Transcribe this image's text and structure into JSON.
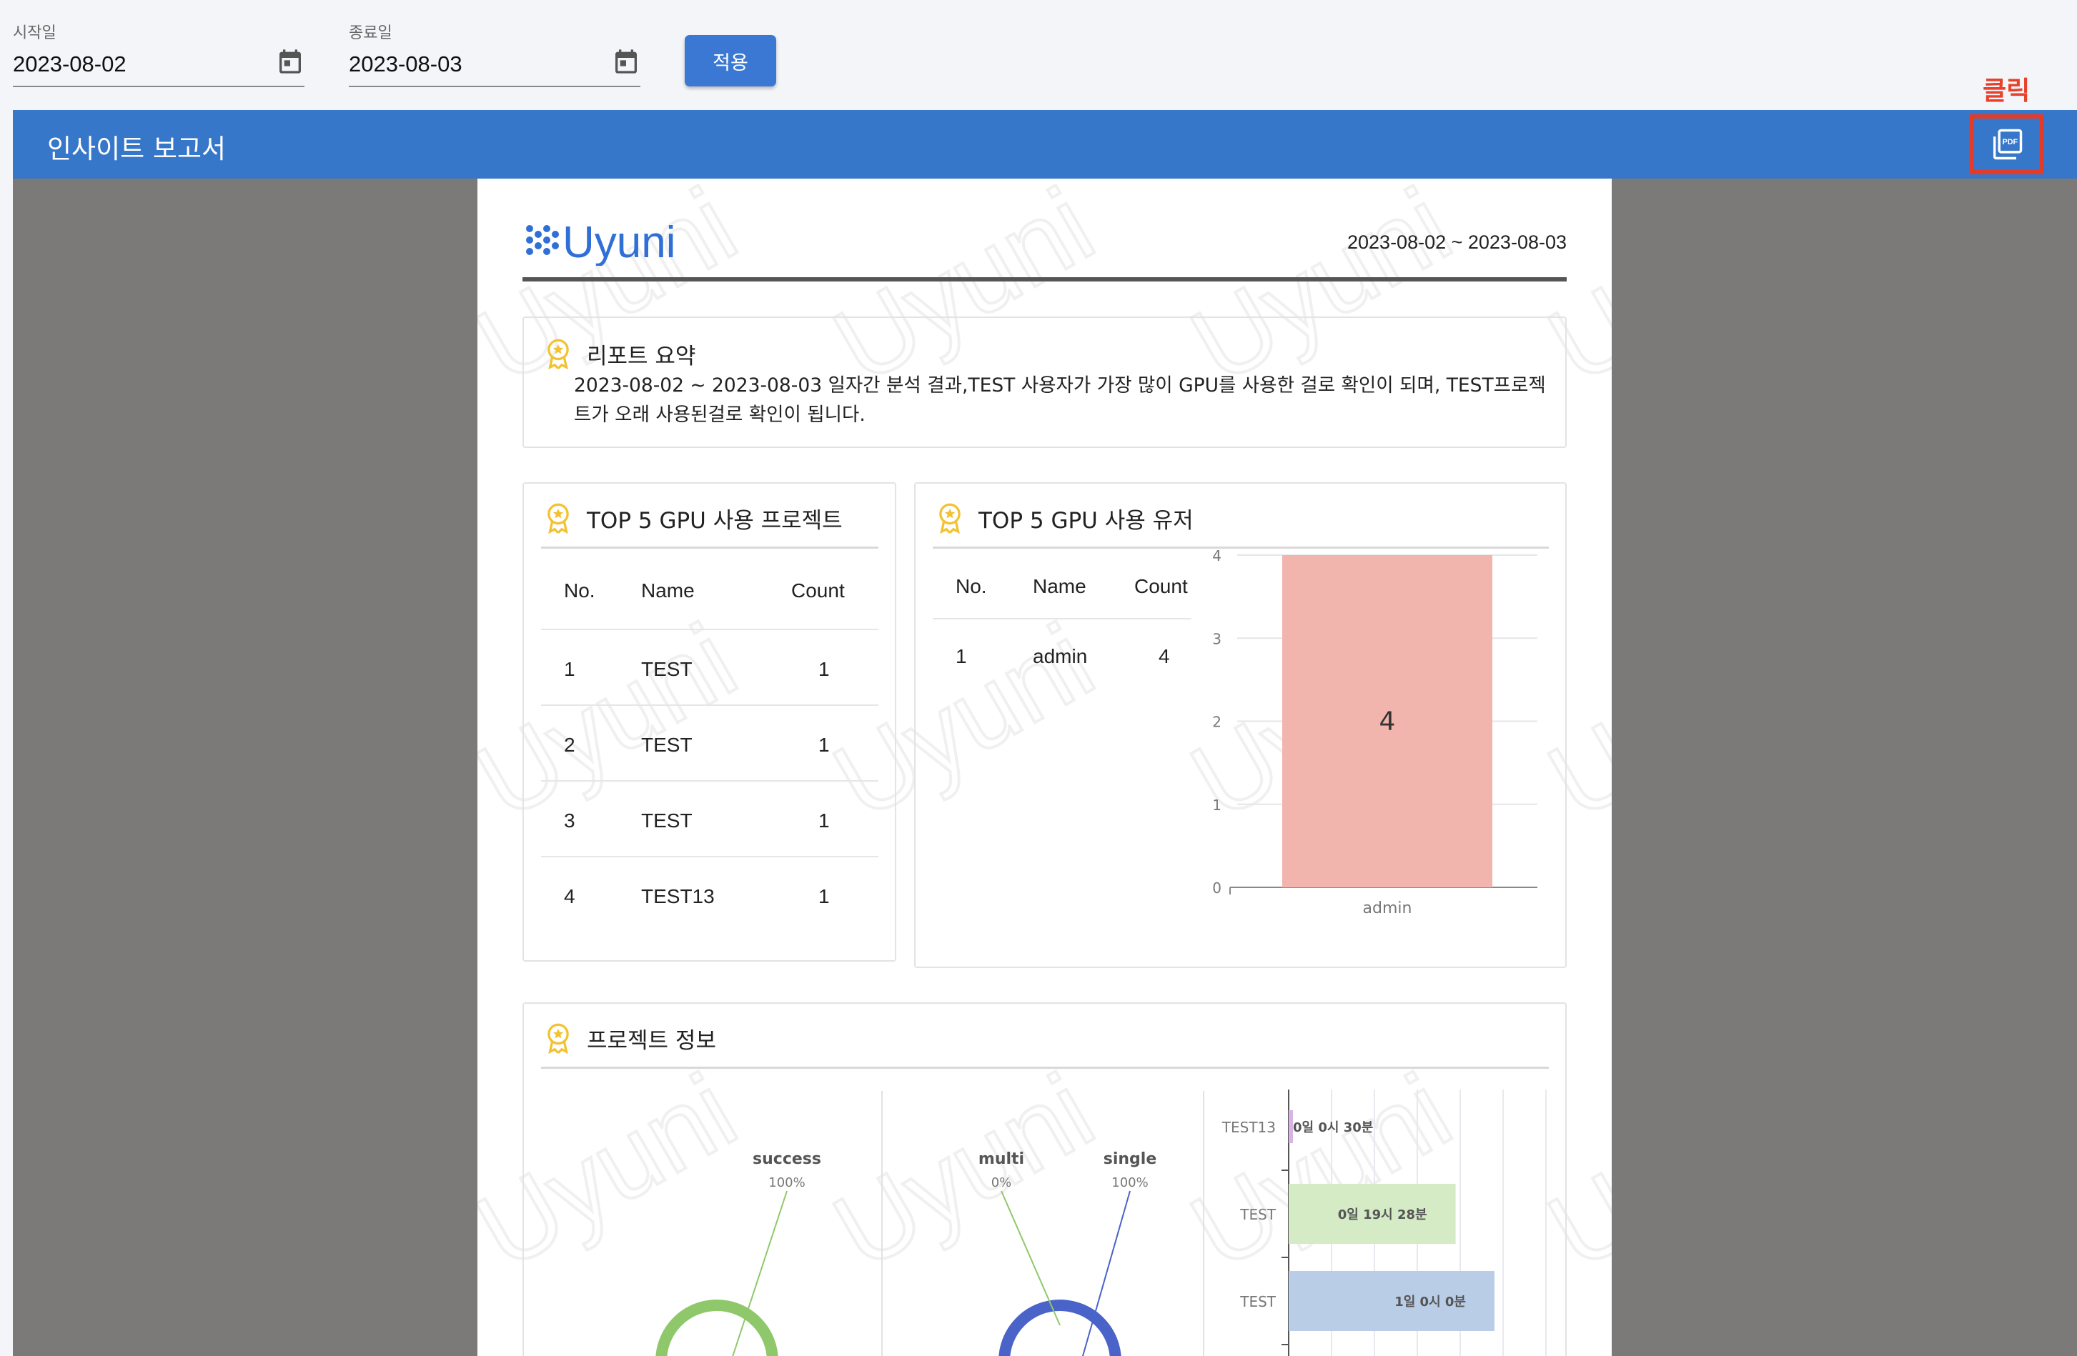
{
  "filters": {
    "start": {
      "label": "시작일",
      "value": "2023-08-02",
      "icon": "calendar-icon"
    },
    "end": {
      "label": "종료일",
      "value": "2023-08-03",
      "icon": "calendar-icon"
    },
    "apply_label": "적용"
  },
  "annotation": {
    "text": "클릭",
    "color": "#e23b2a"
  },
  "report_bar": {
    "title": "인사이트 보고서",
    "pdf_icon": "pdf-icon",
    "pdf_icon_text": "PDF",
    "color": "#3677c9"
  },
  "report": {
    "logo_text": "Uyuni",
    "period": "2023-08-02 ~ 2023-08-03",
    "watermark": "Uyuni",
    "summary": {
      "title": "리포트 요약",
      "text": "2023-08-02 ~ 2023-08-03 일자간 분석 결과,TEST 사용자가 가장 많이 GPU를 사용한 걸로 확인이 되며, TEST프로젝트가 오래 사용된걸로 확인이 됩니다."
    },
    "top_projects": {
      "title": "TOP 5 GPU 사용 프로젝트",
      "columns": [
        "No.",
        "Name",
        "Count"
      ],
      "rows": [
        [
          "1",
          "TEST",
          "1"
        ],
        [
          "2",
          "TEST",
          "1"
        ],
        [
          "3",
          "TEST",
          "1"
        ],
        [
          "4",
          "TEST13",
          "1"
        ]
      ]
    },
    "top_users": {
      "title": "TOP 5 GPU 사용 유저",
      "columns": [
        "No.",
        "Name",
        "Count"
      ],
      "rows": [
        [
          "1",
          "admin",
          "4"
        ]
      ]
    },
    "project_info": {
      "title": "프로젝트 정보"
    }
  },
  "chart_data": [
    {
      "type": "bar",
      "categories": [
        "admin"
      ],
      "values": [
        4
      ],
      "ylim": [
        0,
        4
      ],
      "yticks": [
        "0",
        "1",
        "2",
        "3",
        "4"
      ],
      "data_labels": [
        "4"
      ],
      "grid": true,
      "colors": [
        "#f2b5ae"
      ]
    },
    {
      "type": "pie",
      "labels": [
        "success"
      ],
      "percent_labels": [
        "100%"
      ],
      "values": [
        100
      ],
      "colors": [
        "#8fc86a"
      ]
    },
    {
      "type": "pie",
      "labels": [
        "multi",
        "single"
      ],
      "percent_labels": [
        "0%",
        "100%"
      ],
      "values": [
        0,
        100
      ],
      "colors": [
        "#8fc86a",
        "#4a63c8"
      ]
    },
    {
      "type": "bar",
      "orientation": "horizontal",
      "categories": [
        "TEST13",
        "TEST",
        "TEST"
      ],
      "values": [
        0.5,
        19.4667,
        24
      ],
      "value_unit": "hours",
      "data_labels": [
        "0일 0시 30분",
        "0일 19시 28분",
        "1일 0시 0분"
      ],
      "colors": [
        "#d7b3e6",
        "#d4ebc6",
        "#b9cde6"
      ]
    }
  ]
}
